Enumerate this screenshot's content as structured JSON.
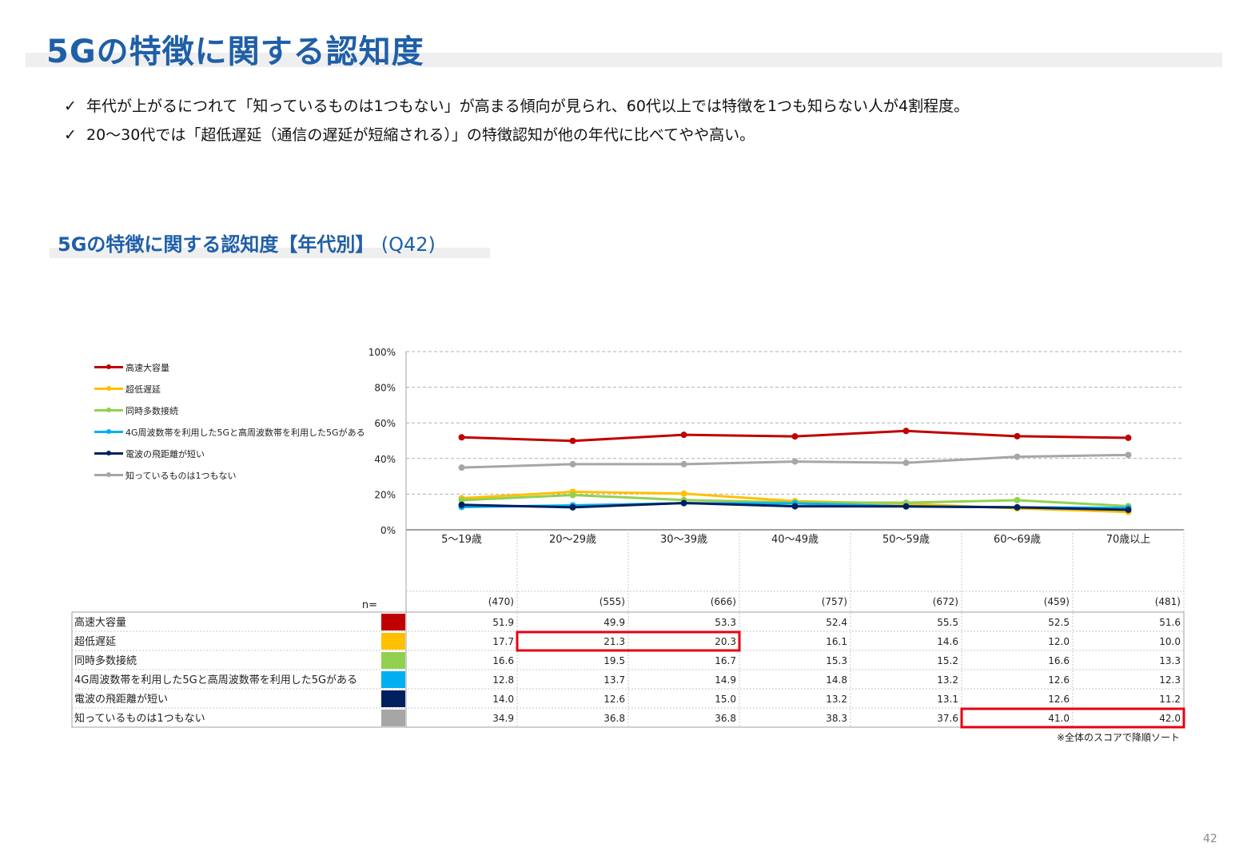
{
  "page_title": "5Gの特徴に関する認知度",
  "bullets": [
    "年代が上がるにつれて「知っているものは1つもない」が高まる傾向が見られ、60代以上では特徴を1つも知らない人が4割程度。",
    "20～30代では「超低遅延（通信の遅延が短縮される）」の特徴認知が他の年代に比べてやや高い。"
  ],
  "check_mark": "✓",
  "section_title": "5Gの特徴に関する認知度【年代別】",
  "section_question": "(Q42)",
  "n_label": "n=",
  "note": "※全体のスコアで降順ソート",
  "page_number": "42",
  "chart_data": {
    "type": "line",
    "categories": [
      "5～19歳",
      "20～29歳",
      "30～39歳",
      "40～49歳",
      "50～59歳",
      "60～69歳",
      "70歳以上"
    ],
    "n_values": [
      "(470)",
      "(555)",
      "(666)",
      "(757)",
      "(672)",
      "(459)",
      "(481)"
    ],
    "y_ticks": [
      "100%",
      "80%",
      "60%",
      "40%",
      "20%",
      "0%"
    ],
    "ylim": [
      0,
      100
    ],
    "grid": true,
    "legend_position": "left",
    "series": [
      {
        "name": "高速大容量",
        "color": "#c00000",
        "values": [
          51.9,
          49.9,
          53.3,
          52.4,
          55.5,
          52.5,
          51.6
        ]
      },
      {
        "name": "超低遅延",
        "color": "#ffc000",
        "values": [
          17.7,
          21.3,
          20.3,
          16.1,
          14.6,
          12.0,
          10.0
        ]
      },
      {
        "name": "同時多数接続",
        "color": "#92d050",
        "values": [
          16.6,
          19.5,
          16.7,
          15.3,
          15.2,
          16.6,
          13.3
        ]
      },
      {
        "name": "4G周波数帯を利用した5Gと高周波数帯を利用した5Gがある",
        "color": "#00b0f0",
        "values": [
          12.8,
          13.7,
          14.9,
          14.8,
          13.2,
          12.6,
          12.3
        ]
      },
      {
        "name": "電波の飛距離が短い",
        "color": "#002060",
        "values": [
          14.0,
          12.6,
          15.0,
          13.2,
          13.1,
          12.6,
          11.2
        ]
      },
      {
        "name": "知っているものは1つもない",
        "color": "#a6a6a6",
        "values": [
          34.9,
          36.8,
          36.8,
          38.3,
          37.6,
          41.0,
          42.0
        ]
      }
    ],
    "highlights": [
      {
        "series": 1,
        "from": 1,
        "to": 2
      },
      {
        "series": 5,
        "from": 5,
        "to": 6
      }
    ]
  }
}
